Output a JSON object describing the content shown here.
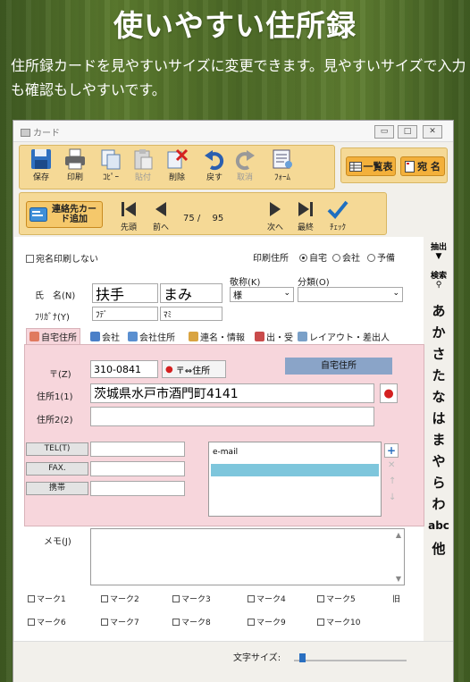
{
  "headline": "使いやすい住所録",
  "description": "住所録カードを見やすいサイズに変更できます。見やすいサイズで入力も確認もしやすいです。",
  "window": {
    "title": "カード"
  },
  "toolbar": {
    "save": "保存",
    "print": "印刷",
    "copy": "ｺﾋﾟｰ",
    "paste": "貼付",
    "delete": "削除",
    "undo": "戻す",
    "cancel": "取消",
    "form": "ﾌｫｰﾑ",
    "list_view": "一覧表",
    "addressee": "宛 名"
  },
  "nav": {
    "add_contact": "連絡先カード追加",
    "first": "先頭",
    "prev": "前へ",
    "position": "75 /　 95",
    "next": "次へ",
    "last": "最終",
    "check": "ﾁｪｯｸ"
  },
  "form": {
    "no_print_label": "宛名印刷しない",
    "print_address_label": "印刷住所",
    "print_options": [
      "自宅",
      "会社",
      "予備"
    ],
    "honorific_label": "敬称(K)",
    "honorific_value": "様",
    "category_label": "分類(O)",
    "category_value": "",
    "name_label": "氏　名(N)",
    "last_name": "扶手",
    "first_name": "まみ",
    "furigana_label": "ﾌﾘｶﾞﾅ(Y)",
    "last_kana": "ﾌﾃﾞ",
    "first_kana": "ﾏﾐ"
  },
  "tabs": [
    "自宅住所",
    "会社",
    "会社住所",
    "連名・情報",
    "出・受",
    "レイアウト・差出人"
  ],
  "address": {
    "zip_label": "〒(Z)",
    "zip": "310-0841",
    "zip_convert": "〒⇔住所",
    "section_title": "自宅住所",
    "addr1_label": "住所1(1)",
    "addr1": "茨城県水戸市酒門町4141",
    "addr2_label": "住所2(2)",
    "addr2": "",
    "tel_label": "TEL(T)",
    "fax_label": "FAX.",
    "mobile_label": "携帯",
    "email_header": "e-mail"
  },
  "memo_label": "メモ(J)",
  "marks": [
    "マーク1",
    "マーク2",
    "マーク3",
    "マーク4",
    "マーク5",
    "マーク6",
    "マーク7",
    "マーク8",
    "マーク9",
    "マーク10"
  ],
  "marks_side": "旧",
  "side": {
    "extract": "抽出",
    "search": "検索",
    "kana": [
      "あ",
      "か",
      "さ",
      "た",
      "な",
      "は",
      "ま",
      "や",
      "ら",
      "わ"
    ],
    "abc": "abc",
    "other": "他"
  },
  "footer": {
    "font_size_label": "文字サイズ:",
    "font_size": 0.05
  }
}
